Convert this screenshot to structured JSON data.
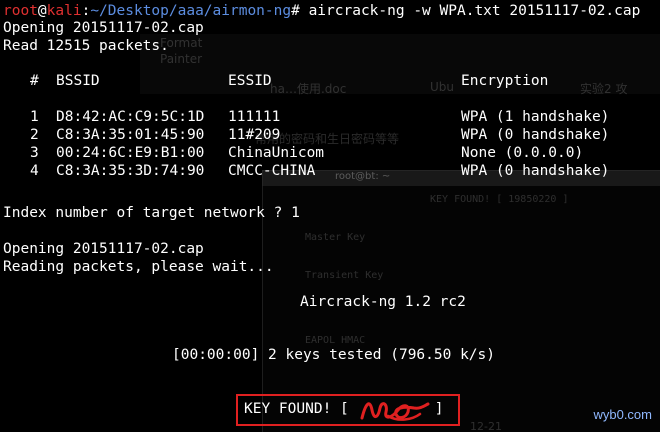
{
  "colors": {
    "background": "#000000",
    "text": "#ffffff",
    "prompt_user": "#e03030",
    "prompt_path": "#5c8de0",
    "highlight_box": "#e02020"
  },
  "prompt": {
    "user": "root",
    "at": "@",
    "host": "kali",
    "colon": ":",
    "path": "~/Desktop/aaa/airmon-ng",
    "symbol": "#",
    "command": " aircrack-ng -w WPA.txt 20151117-02.cap"
  },
  "output": {
    "opening": "Opening 20151117-02.cap",
    "read": "Read 12515 packets.",
    "table_headers": {
      "num": "#",
      "bssid": "BSSID",
      "essid": "ESSID",
      "encryption": "Encryption"
    },
    "networks": [
      {
        "num": "1",
        "bssid": "D8:42:AC:C9:5C:1D",
        "essid": "111111",
        "encryption": "WPA (1 handshake)"
      },
      {
        "num": "2",
        "bssid": "C8:3A:35:01:45:90",
        "essid": "11#209",
        "encryption": "WPA (0 handshake)"
      },
      {
        "num": "3",
        "bssid": "00:24:6C:E9:B1:00",
        "essid": "ChinaUnicom",
        "encryption": "None (0.0.0.0)"
      },
      {
        "num": "4",
        "bssid": "C8:3A:35:3D:74:90",
        "essid": "CMCC-CHINA",
        "encryption": "WPA (0 handshake)"
      }
    ],
    "index_prompt": "Index number of target network ? 1",
    "opening2": "Opening 20151117-02.cap",
    "reading": "Reading packets, please wait...",
    "banner": "Aircrack-ng 1.2 rc2",
    "progress": "[00:00:00] 2 keys tested (796.50 k/s)",
    "key_found_prefix": "KEY FOUND! [",
    "key_found_suffix": "]"
  },
  "background_ghosts": {
    "doc_tab": "ha…使用.doc",
    "ubuntu_tab": "Ubu",
    "lab_tab": "实验2 攻",
    "format_label": "Format",
    "painter_label": "Painter",
    "chinese_hint": "常用的密码和生日密码等等",
    "inner_title": "root@bt: ~",
    "inner_key_found": "KEY FOUND! [ 19850220 ]",
    "inner_master_key": "Master Key",
    "inner_transient_key": "Transient Key",
    "inner_eapol": "EAPOL HMAC",
    "bottom_label": "12-21"
  },
  "watermark": "wyb0.com"
}
